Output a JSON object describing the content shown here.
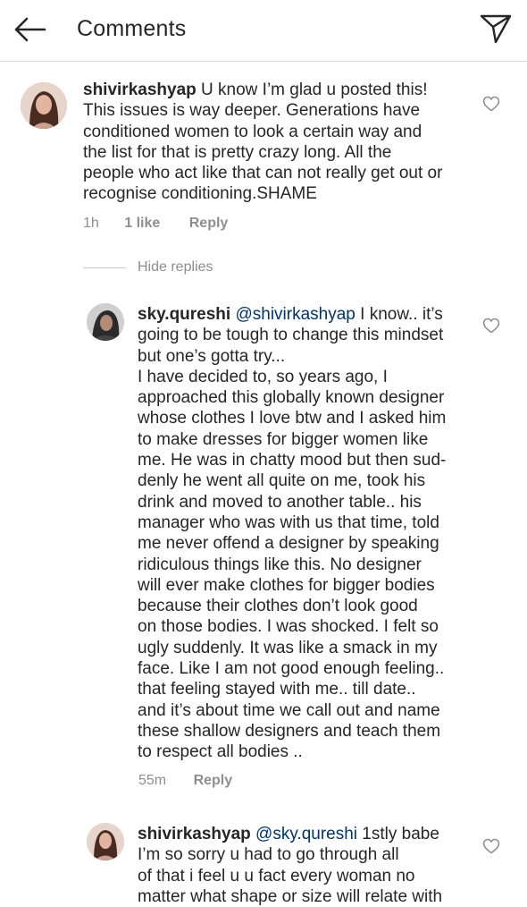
{
  "header": {
    "title": "Comments"
  },
  "comments": [
    {
      "username": "shivirkashyap",
      "text_lines": [
        "U know I’m glad u posted this!",
        "This issues is way deeper. Generations have",
        "conditioned women to look a certain way and",
        "the list for that is pretty crazy long. All the",
        "people who act like that can not really get out or",
        "recognise conditioning.SHAME"
      ],
      "time": "1h",
      "likes": "1 like",
      "reply": "Reply"
    }
  ],
  "hide_replies": "Hide replies",
  "replies": [
    {
      "username": "sky.qureshi",
      "mention": "@shivirkashyap",
      "text_lines": [
        "I know.. it’s",
        "going to be tough to change this mindset",
        "but one’s gotta try...",
        "I have decided to, so years ago, I",
        "approached this globally known designer",
        "whose clothes I love btw and I asked him",
        "to make dresses for bigger women like",
        "me. He was in chatty mood but then sud-",
        "denly he went all quite on me, took his",
        "drink and moved to another table.. his",
        "manager who was with us that time, told",
        "me never offend a designer by speaking",
        "ridiculous things like this. No designer",
        "will ever make clothes for bigger bodies",
        "because their clothes don’t look good",
        "on those bodies. I was shocked. I felt so",
        "ugly suddenly. It was like a smack in my",
        "face. Like I am not good enough feeling..",
        "that feeling stayed with me.. till date..",
        "and it’s about time we call out and name",
        "these shallow designers and teach them",
        "to respect all bodies .."
      ],
      "time": "55m",
      "reply": "Reply"
    },
    {
      "username": "shivirkashyap",
      "mention": "@sky.qureshi",
      "text_lines": [
        "1stly babe",
        "I’m so sorry u had to go through all",
        "of that i feel u u fact every woman no",
        "matter what shape or size will relate with"
      ]
    }
  ],
  "colors": {
    "text": "#262626",
    "muted": "#8e8e8e",
    "mention": "#003569",
    "divider": "#dbdbdb"
  },
  "icons": {
    "back": "arrow-left-icon",
    "send": "paper-plane-icon",
    "like": "heart-outline-icon"
  }
}
